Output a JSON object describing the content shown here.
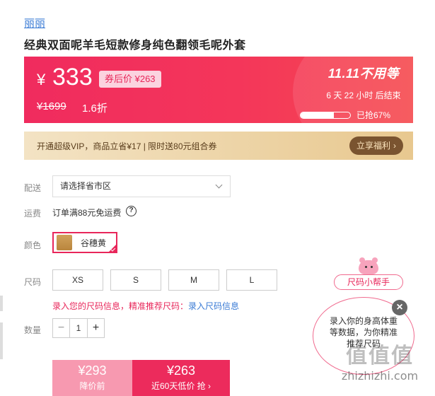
{
  "brand": "丽丽",
  "product_title": "经典双面呢羊毛短款修身纯色翻领毛呢外套",
  "price_panel": {
    "currency": "¥",
    "price": "333",
    "coupon_price": "券后价 ¥263",
    "original_price": "¥1699",
    "discount": "1.6折",
    "promo_title": "11.11不用等",
    "countdown": "6 天 22 小时 后结束",
    "sold_text": "已抢67%",
    "sold_fraction": 0.67
  },
  "vip": {
    "text": "开通超级VIP，商品立省¥17 | 限时送80元组合券",
    "button": "立享福利",
    "button_icon": "chevron-right-icon"
  },
  "delivery": {
    "label": "配送",
    "placeholder": "请选择省市区"
  },
  "shipping": {
    "label": "运费",
    "text": "订单满88元免运费",
    "icon": "help-icon"
  },
  "color": {
    "label": "颜色",
    "options": [
      "谷穗黄"
    ]
  },
  "size": {
    "label": "尺码",
    "options": [
      "XS",
      "S",
      "M",
      "L"
    ],
    "hint": "录入您的尺码信息，精准推荐尺码：",
    "hint_link": "录入尺码信息"
  },
  "quantity": {
    "label": "数量",
    "value": "1",
    "minus": "−",
    "plus": "+"
  },
  "buy": {
    "left_price": "¥293",
    "left_label": "降价前",
    "right_price": "¥263",
    "right_label": "近60天低价 抢 ›"
  },
  "helper": {
    "pill": "尺码小帮手",
    "bubble": "录入你的身高体重等数据，为你精准推荐尺码",
    "close": "×"
  },
  "watermark": {
    "logo": "值值值",
    "url": "zhizhizhi.com"
  }
}
